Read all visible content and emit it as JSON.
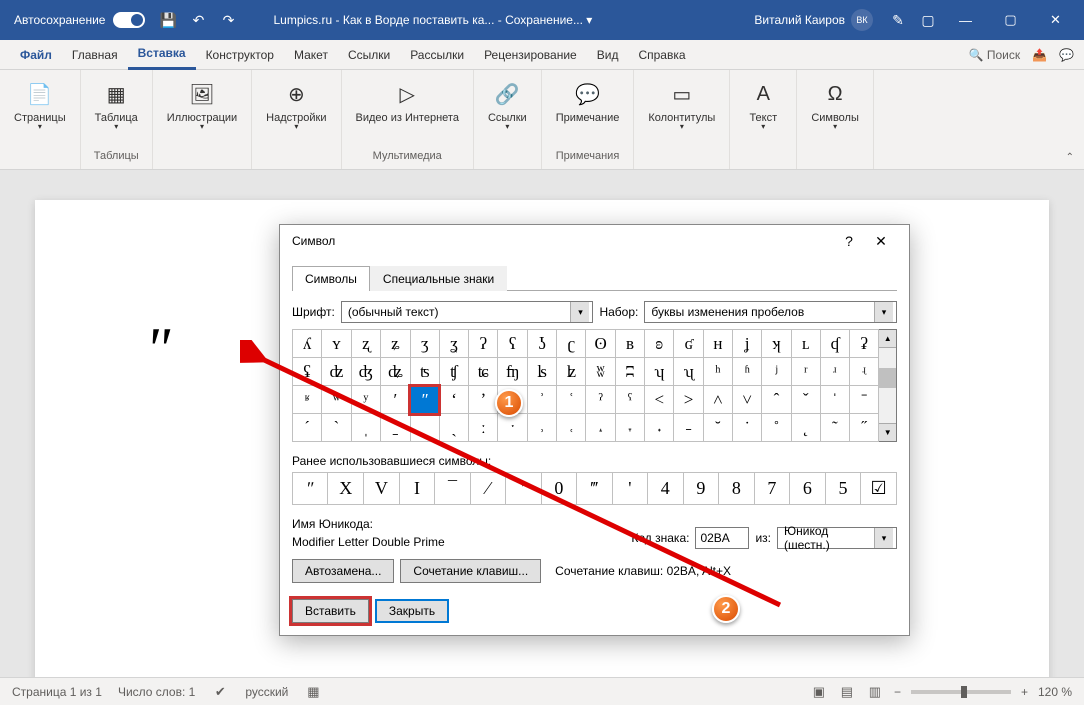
{
  "titlebar": {
    "autosave_label": "Автосохранение",
    "doc_title": "Lumpics.ru - Как в Ворде поставить ка... - Сохранение... ▾",
    "user_name": "Виталий Каиров",
    "user_initials": "ВК"
  },
  "tabs": {
    "file": "Файл",
    "items": [
      "Главная",
      "Вставка",
      "Конструктор",
      "Макет",
      "Ссылки",
      "Рассылки",
      "Рецензирование",
      "Вид",
      "Справка"
    ],
    "active_index": 1,
    "search": "Поиск"
  },
  "ribbon": {
    "groups": [
      {
        "label": "",
        "buttons": [
          {
            "icon": "📄",
            "label": "Страницы",
            "drop": true
          }
        ]
      },
      {
        "label": "Таблицы",
        "buttons": [
          {
            "icon": "▦",
            "label": "Таблица",
            "drop": true
          }
        ]
      },
      {
        "label": "",
        "buttons": [
          {
            "icon": "🖼",
            "label": "Иллюстрации",
            "drop": true
          }
        ]
      },
      {
        "label": "",
        "buttons": [
          {
            "icon": "⊕",
            "label": "Надстройки",
            "drop": true
          }
        ]
      },
      {
        "label": "Мультимедиа",
        "buttons": [
          {
            "icon": "▷",
            "label": "Видео из Интернета"
          }
        ]
      },
      {
        "label": "",
        "buttons": [
          {
            "icon": "🔗",
            "label": "Ссылки",
            "drop": true
          }
        ]
      },
      {
        "label": "Примечания",
        "buttons": [
          {
            "icon": "💬",
            "label": "Примечание"
          }
        ]
      },
      {
        "label": "",
        "buttons": [
          {
            "icon": "▭",
            "label": "Колонтитулы",
            "drop": true
          }
        ]
      },
      {
        "label": "",
        "buttons": [
          {
            "icon": "A",
            "label": "Текст",
            "drop": true
          }
        ]
      },
      {
        "label": "",
        "buttons": [
          {
            "icon": "Ω",
            "label": "Символы",
            "drop": true
          }
        ]
      }
    ]
  },
  "document": {
    "text": "ʺ"
  },
  "statusbar": {
    "page": "Страница 1 из 1",
    "words": "Число слов: 1",
    "lang": "русский",
    "zoom": "120 %"
  },
  "dialog": {
    "title": "Символ",
    "tabs": [
      "Символы",
      "Специальные знаки"
    ],
    "active_tab": 0,
    "font_label": "Шрифт:",
    "font_value": "(обычный текст)",
    "set_label": "Набор:",
    "set_value": "буквы изменения пробелов",
    "grid": [
      [
        "ʎ",
        "ʏ",
        "ʐ",
        "ʑ",
        "ʒ",
        "ʓ",
        "ʔ",
        "ʕ",
        "ʖ",
        "ʗ",
        "ʘ",
        "ʙ",
        "ʚ",
        "ʛ",
        "ʜ",
        "ʝ",
        "ʞ",
        "ʟ",
        "ʠ",
        "ʡ"
      ],
      [
        "ʢ",
        "ʣ",
        "ʤ",
        "ʥ",
        "ʦ",
        "ʧ",
        "ʨ",
        "ʩ",
        "ʪ",
        "ʫ",
        "ʬ",
        "ʭ",
        "ʮ",
        "ʯ",
        "ʰ",
        "ʱ",
        "ʲ",
        "ʳ",
        "ʴ",
        "ʵ"
      ],
      [
        "ʶ",
        "ʷ",
        "ʸ",
        "ʹ",
        "ʺ",
        "ʻ",
        "ʼ",
        "ʽ",
        "ʾ",
        "ʿ",
        "ˀ",
        "ˁ",
        "˂",
        "˃",
        "˄",
        "˅",
        "ˆ",
        "ˇ",
        "ˈ",
        "ˉ"
      ],
      [
        "ˊ",
        "ˋ",
        "ˌ",
        "ˍ",
        "ˎ",
        "ˏ",
        "ː",
        "ˑ",
        "˒",
        "˓",
        "˔",
        "˕",
        "˖",
        "˗",
        "˘",
        "˙",
        "˚",
        "˛",
        "˜",
        "˝"
      ]
    ],
    "selected": {
      "row": 2,
      "col": 4
    },
    "recent_label": "Ранее использовавшиеся символы:",
    "recent": [
      "ʺ",
      "X",
      "V",
      "I",
      "¯",
      "⁄",
      "′",
      "0",
      "‴",
      "'",
      "4",
      "9",
      "8",
      "7",
      "6",
      "5",
      "☑"
    ],
    "unicode_name_label": "Имя Юникода:",
    "unicode_name_value": "Modifier Letter Double Prime",
    "code_label": "Код знака:",
    "code_value": "02BA",
    "from_label": "из:",
    "from_value": "Юникод (шестн.)",
    "autocorrect_btn": "Автозамена...",
    "shortcut_btn": "Сочетание клавиш...",
    "shortcut_label": "Сочетание клавиш: 02BA, Alt+X",
    "insert_btn": "Вставить",
    "close_btn": "Закрыть"
  },
  "callouts": {
    "one": "1",
    "two": "2"
  }
}
